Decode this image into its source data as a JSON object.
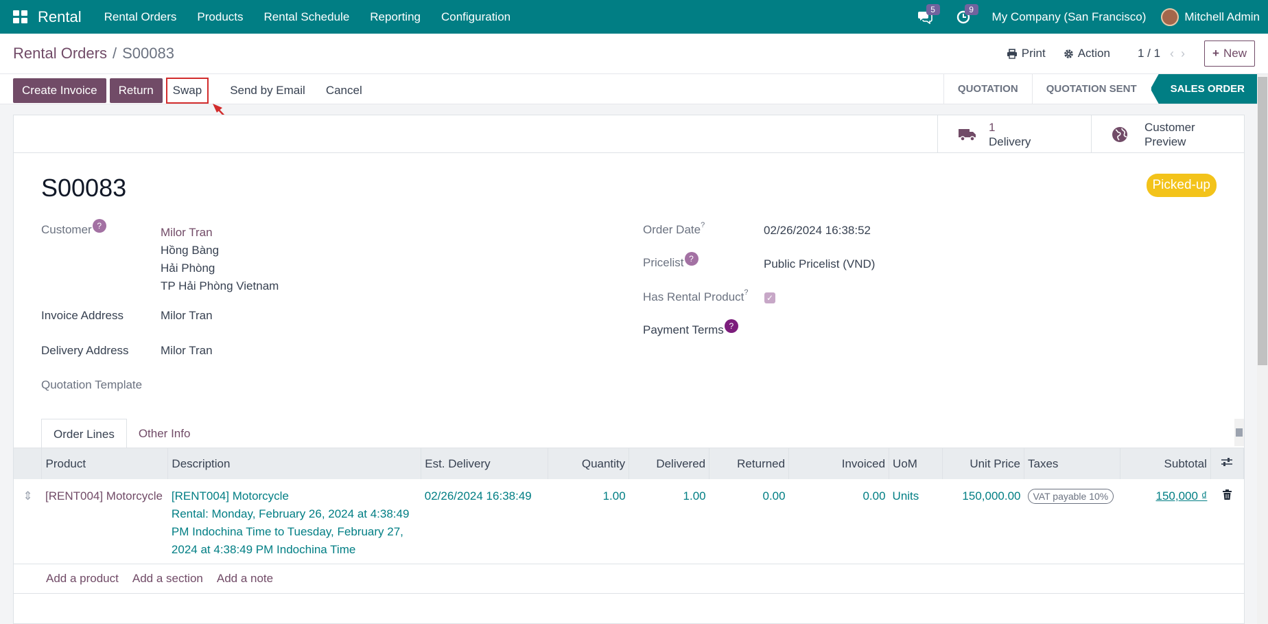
{
  "app": {
    "name": "Rental"
  },
  "menu": [
    "Rental Orders",
    "Products",
    "Rental Schedule",
    "Reporting",
    "Configuration"
  ],
  "systray": {
    "messages_count": "5",
    "activities_count": "9",
    "company": "My Company (San Francisco)",
    "user": "Mitchell Admin"
  },
  "breadcrumb": {
    "parent": "Rental Orders",
    "separator": "/",
    "current": "S00083"
  },
  "control": {
    "print": "Print",
    "action": "Action",
    "pager": "1 / 1",
    "new": "New"
  },
  "actions": {
    "create_invoice": "Create Invoice",
    "return": "Return",
    "swap": "Swap",
    "send_email": "Send by Email",
    "cancel": "Cancel"
  },
  "stages": [
    "QUOTATION",
    "QUOTATION SENT",
    "SALES ORDER"
  ],
  "smart_buttons": {
    "delivery_count": "1",
    "delivery_label": "Delivery",
    "preview_1": "Customer",
    "preview_2": "Preview"
  },
  "order": {
    "name": "S00083",
    "status": "Picked-up",
    "customer_label": "Customer",
    "customer_name": "Milor Tran",
    "customer_addr1": "Hồng Bàng",
    "customer_addr2": "Hải Phòng",
    "customer_addr3": "TP Hải Phòng Vietnam",
    "invoice_label": "Invoice Address",
    "invoice_value": "Milor Tran",
    "delivery_label": "Delivery Address",
    "delivery_value": "Milor Tran",
    "template_label": "Quotation Template",
    "order_date_label": "Order Date",
    "order_date": "02/26/2024 16:38:52",
    "pricelist_label": "Pricelist",
    "pricelist": "Public Pricelist (VND)",
    "rental_label": "Has Rental Product",
    "payment_label": "Payment Terms",
    "qmark": "?"
  },
  "tabs": [
    "Order Lines",
    "Other Info"
  ],
  "columns": [
    "Product",
    "Description",
    "Est. Delivery",
    "Quantity",
    "Delivered",
    "Returned",
    "Invoiced",
    "UoM",
    "Unit Price",
    "Taxes",
    "Subtotal"
  ],
  "line": {
    "product": "[RENT004] Motorcycle",
    "desc1": "[RENT004] Motorcycle",
    "desc2": "Rental: Monday, February 26, 2024 at 4:38:49",
    "desc3": "PM Indochina Time to Tuesday, February 27,",
    "desc4": "2024 at 4:38:49 PM Indochina Time",
    "est_delivery": "02/26/2024 16:38:49",
    "quantity": "1.00",
    "delivered": "1.00",
    "returned": "0.00",
    "invoiced": "0.00",
    "uom": "Units",
    "unit_price": "150,000.00",
    "tax": "VAT payable 10%",
    "subtotal": "150,000 ₫"
  },
  "add_links": [
    "Add a product",
    "Add a section",
    "Add a note"
  ],
  "colors": {
    "brand": "#017e84",
    "primary": "#714b67",
    "status": "#f3c31a",
    "highlight": "#d22c2c"
  }
}
